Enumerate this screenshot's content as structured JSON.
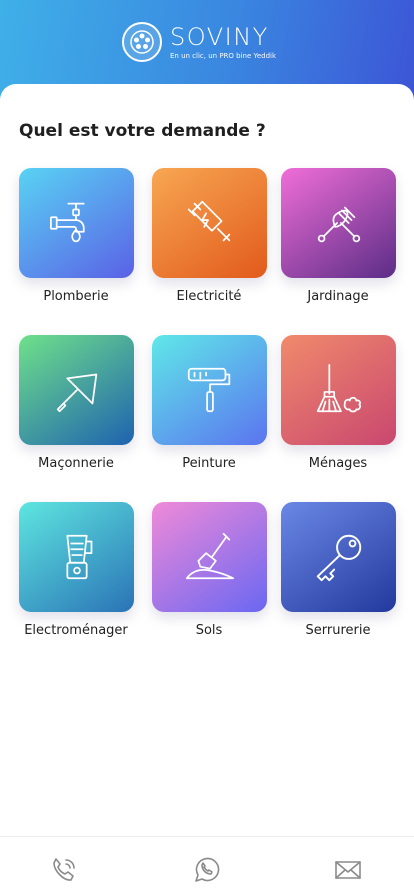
{
  "brand": {
    "name": "SOVINY",
    "tagline": "En un clic, un PRO bine Yeddik"
  },
  "question": "Quel est votre demande ?",
  "services": [
    {
      "label": "Plomberie",
      "icon": "faucet-icon",
      "gradient": [
        "#59d3f4",
        "#5a61e6"
      ]
    },
    {
      "label": "Electricité",
      "icon": "electric-plug-icon",
      "gradient": [
        "#f7a752",
        "#e25a1c"
      ]
    },
    {
      "label": "Jardinage",
      "icon": "garden-tools-icon",
      "gradient": [
        "#f06ed8",
        "#5b2d86"
      ]
    },
    {
      "label": "Maçonnerie",
      "icon": "trowel-icon",
      "gradient": [
        "#6fe18a",
        "#1e62b0"
      ]
    },
    {
      "label": "Peinture",
      "icon": "paint-roller-icon",
      "gradient": [
        "#5fe8e8",
        "#5b74f0"
      ]
    },
    {
      "label": "Ménages",
      "icon": "broom-icon",
      "gradient": [
        "#f08a6c",
        "#c9476f"
      ]
    },
    {
      "label": "Electroménager",
      "icon": "blender-icon",
      "gradient": [
        "#5ee6e0",
        "#2a73b6"
      ]
    },
    {
      "label": "Sols",
      "icon": "shovel-icon",
      "gradient": [
        "#f08ad8",
        "#6a67f2"
      ]
    },
    {
      "label": "Serrurerie",
      "icon": "key-icon",
      "gradient": [
        "#6b88e6",
        "#23399d"
      ]
    }
  ],
  "bottom_nav": [
    {
      "icon": "phone-icon"
    },
    {
      "icon": "whatsapp-icon"
    },
    {
      "icon": "mail-icon"
    }
  ],
  "colors": {
    "header_start": "#3fb0e8",
    "header_end": "#3d54d6",
    "nav_icon": "#8a8a8a"
  }
}
